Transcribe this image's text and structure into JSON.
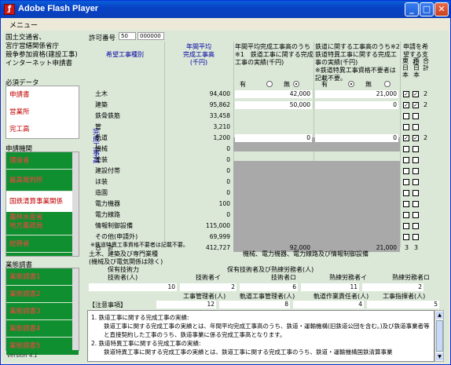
{
  "window": {
    "title": "Adobe Flash Player",
    "min": "_",
    "max": "□",
    "close": "✕"
  },
  "menu": {
    "label": "メニュー"
  },
  "agency": [
    "国土交通省、",
    "宮庁営繕関係省庁",
    "競争参加資格(建設工事)",
    "インターネット申請書"
  ],
  "sidebar": {
    "required_title": "必須データ",
    "required": [
      "申請書",
      "営業所",
      "完工高"
    ],
    "org_title": "申請機関",
    "orgs": [
      "環境省",
      "最高裁判所",
      "国鉄清算事業関係",
      "農林水産省\n地方農政局",
      "総務省"
    ],
    "survey_title": "業態調書",
    "surveys": [
      "業態調書1",
      "業態調書2",
      "業態調書3",
      "業態調書4",
      "業態調書5"
    ]
  },
  "version": "version 4.1",
  "permit": {
    "label": "許可番号",
    "value1": "50",
    "value2": "000000"
  },
  "table": {
    "col_type": "希望工事種別",
    "col_avg": "年間平均\n完成工事高\n(千円)",
    "col_general": "年間平均完成工事高のうち※1　鉄道工事に関する完成工事の実績(千円)",
    "col_rail": "鉄道に関する工事高のうち※2　鉄道特異工事に関する完成工事の実績(千円)\n※鉄道特異工事資格不要者は記載不要。",
    "col_hope": "申請を希望する支社",
    "col_east": "東日本",
    "col_west": "西日本",
    "col_sum": "合計",
    "radio_yes": "有",
    "radio_no": "無",
    "vert_label": "完成工事高",
    "rows": [
      {
        "name": "土木",
        "avg": "94,400",
        "gen": "42,000",
        "rail": "21,000",
        "e": true,
        "w": true,
        "t": "2"
      },
      {
        "name": "建築",
        "avg": "95,862",
        "gen": "50,000",
        "rail": "0",
        "e": true,
        "w": true,
        "t": "2"
      },
      {
        "name": "鉄骨鉄筋",
        "avg": "33,458",
        "gen": "",
        "rail": "",
        "e": false,
        "w": false,
        "t": ""
      },
      {
        "name": "管",
        "avg": "3,210",
        "gen": "",
        "rail": "",
        "e": false,
        "w": false,
        "t": ""
      },
      {
        "name": "軌道",
        "avg": "1,200",
        "gen": "0",
        "rail": "0",
        "e": true,
        "w": true,
        "t": "2"
      },
      {
        "name": "機械",
        "avg": "0",
        "gen": "",
        "rail": "",
        "e": false,
        "w": false,
        "t": ""
      },
      {
        "name": "塗装",
        "avg": "0",
        "gen": "",
        "rail": "",
        "e": false,
        "w": false,
        "t": ""
      },
      {
        "name": "建設付帯",
        "avg": "0",
        "gen": "",
        "rail": "",
        "e": false,
        "w": false,
        "t": ""
      },
      {
        "name": "ほ装",
        "avg": "0",
        "gen": "",
        "rail": "",
        "e": false,
        "w": false,
        "t": ""
      },
      {
        "name": "造園",
        "avg": "0",
        "gen": "",
        "rail": "",
        "e": false,
        "w": false,
        "t": ""
      },
      {
        "name": "電力機器",
        "avg": "100",
        "gen": "",
        "rail": "",
        "e": false,
        "w": false,
        "t": ""
      },
      {
        "name": "電力線路",
        "avg": "0",
        "gen": "",
        "rail": "",
        "e": false,
        "w": false,
        "t": ""
      },
      {
        "name": "情報制御設備",
        "avg": "115,000",
        "gen": "",
        "rail": "",
        "e": false,
        "w": false,
        "t": ""
      },
      {
        "name": "その他(申請外)",
        "avg": "69,999",
        "gen": "",
        "rail": "",
        "e": false,
        "w": false,
        "t": ""
      },
      {
        "name": "合　計",
        "avg": "412,727",
        "gen": "92,000",
        "rail": "21,000",
        "e_count": "3",
        "w_count": "3",
        "t": ""
      }
    ],
    "note": "※鉄道特異工事資格不要者は記載不要。"
  },
  "lower": {
    "left_head": "土木、建築及び専門業種\n(機械及び電気関係は除く)",
    "right_head": "機械、電力機器、電力線路及び情報制御設備",
    "row1_left_a": "保有技術力",
    "row1_left_b": "技術者(人)",
    "row1_mid": "技術者イ",
    "row1_mid2": "保有技術者及び熟練労務者(人)",
    "row1_r1": "技術者ロ",
    "row1_r2": "熟練労務者イ",
    "row1_r3": "熟練労務者ロ",
    "val_tech": "10",
    "val_i": "2",
    "val_ro": "6",
    "val_ji": "11",
    "val_jr": "2",
    "row2_a": "工事管理者(人)",
    "row2_b": "軌道工事管理者(人)",
    "row2_c": "軌道作業責任者(人)",
    "row2_d": "工事指揮者(人)",
    "val_kanri": "12",
    "val_kido": "8",
    "val_sagyo": "4",
    "val_shiki": "5"
  },
  "notice": {
    "title": "【注意事項】",
    "lines": [
      "1. 鉄道工事に関する完成工事の実績:",
      "鉄道工事に関する完成工事の実績とは、年間平均完成工事高のうち、鉄道・運輸機構(旧鉄道公団を含む。)及び鉄道事業者等と直接契約した工事のうち、鉄道事業に係る完成工事高となります。",
      "2. 鉄道特異工事に関する完成工事の実績:",
      "鉄道特異工事に関する完成工事の実績とは、鉄道工事に関する完成工事のうち、鉄道・運輸機構国鉄清算事業"
    ]
  }
}
